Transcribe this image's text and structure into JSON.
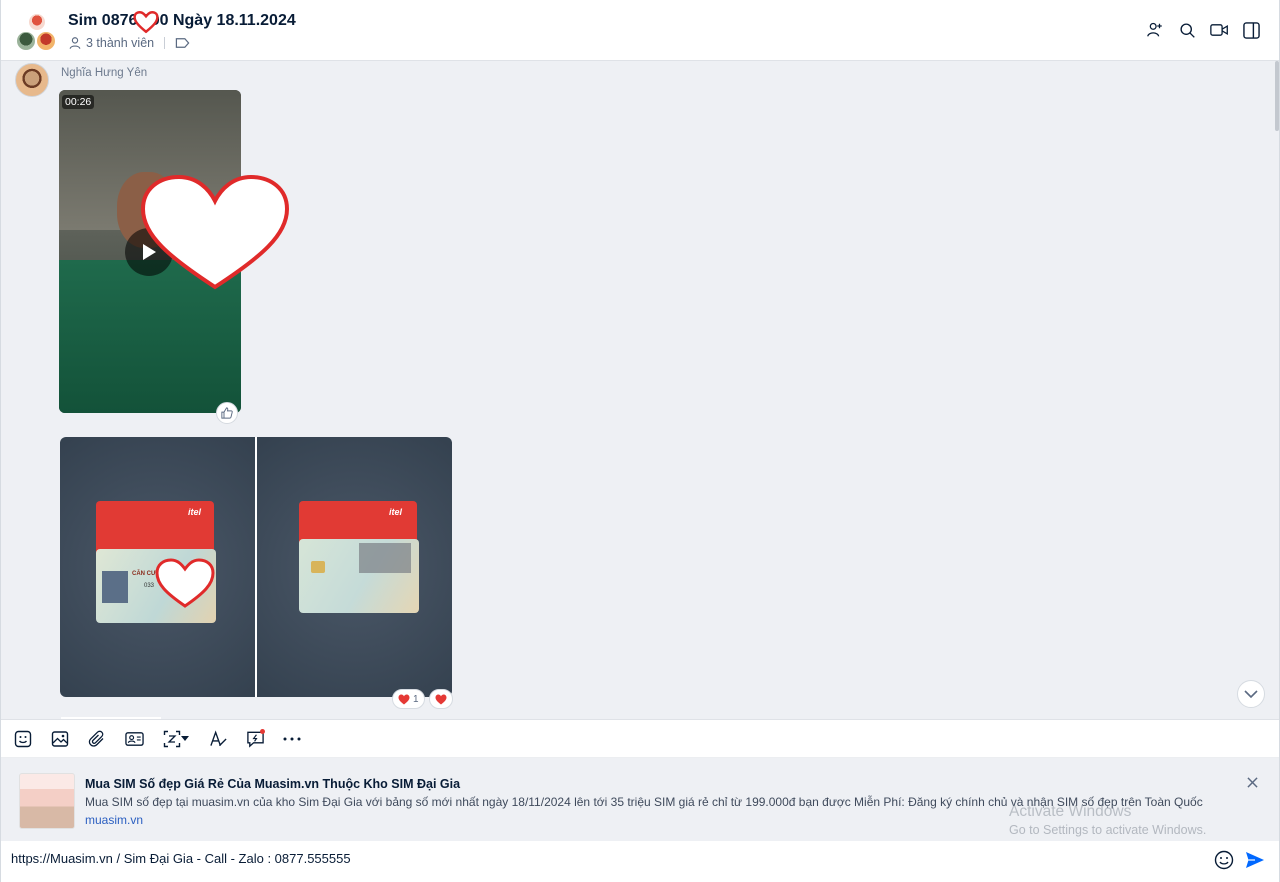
{
  "header": {
    "title": "Sim 0876  990 Ngày 18.11.2024",
    "members": "3 thành viên"
  },
  "message": {
    "sender": "Nghĩa Hưng Yên",
    "video_duration": "00:26"
  },
  "photos": {
    "left_card_label": "CĂN CƯỚC",
    "left_card_number": "033",
    "itel_label": "itel",
    "reaction_count": "1"
  },
  "link_preview": {
    "title": "Mua SIM Số đẹp Giá Rẻ Của Muasim.vn Thuộc Kho SIM Đại Gia",
    "description": "Mua SIM số đẹp tại muasim.vn của kho Sim Đại Gia với bảng số mới nhất ngày 18/11/2024 lên tới 35 triệu SIM giá rẻ chỉ từ 199.000đ bạn được Miễn Phí: Đăng ký chính chủ và nhận SIM số đẹp trên Toàn Quốc",
    "domain": "muasim.vn"
  },
  "watermark": {
    "line1": "Activate Windows",
    "line2": "Go to Settings to activate Windows."
  },
  "composer": {
    "text": "https://Muasim.vn / Sim Đại Gia - Call - Zalo : 0877.555555"
  },
  "colors": {
    "accent": "#0068ff",
    "heart": "#e02a2a",
    "background": "#eef0f4"
  }
}
